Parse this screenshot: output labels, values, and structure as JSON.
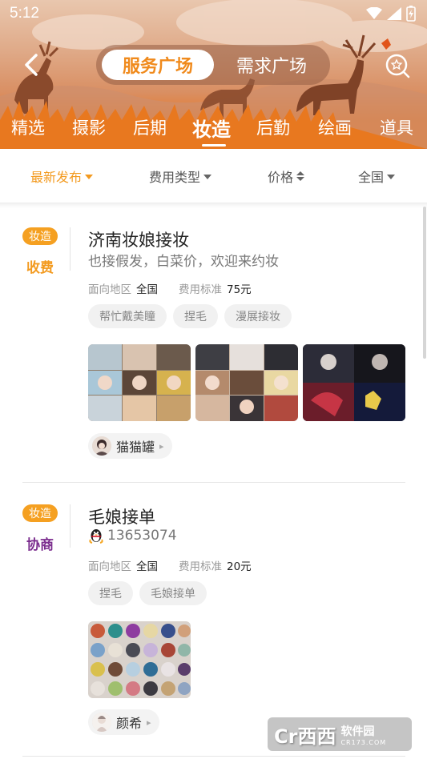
{
  "status_bar": {
    "time": "5:12"
  },
  "header": {
    "segment": {
      "active": "服务广场",
      "inactive": "需求广场"
    },
    "categories": [
      "精选",
      "摄影",
      "后期",
      "妆造",
      "后勤",
      "绘画",
      "道具"
    ],
    "active_category": "妆造",
    "colors": {
      "accent": "#e8781f",
      "active_text": "#f08a1c"
    }
  },
  "filters": {
    "latest": "最新发布",
    "fee_type": "费用类型",
    "price": "价格",
    "region": "全国",
    "active_color": "#f39a1f"
  },
  "cards": [
    {
      "category_badge": "妆造",
      "price_type": "收费",
      "price_type_color": "#f39a1f",
      "title": "济南妆娘接妆",
      "description": "也接假发，白菜价，欢迎来约妆",
      "meta": {
        "region_label": "面向地区",
        "region_value": "全国",
        "fee_label": "费用标准",
        "fee_value": "75元"
      },
      "tags": [
        "帮忙戴美瞳",
        "捏毛",
        "漫展接妆"
      ],
      "user": {
        "name": "猫猫罐"
      }
    },
    {
      "category_badge": "妆造",
      "price_type": "协商",
      "price_type_color": "#7b2d8e",
      "title": "毛娘接单",
      "qq": "13653074",
      "meta": {
        "region_label": "面向地区",
        "region_value": "全国",
        "fee_label": "费用标准",
        "fee_value": "20元"
      },
      "tags": [
        "捏毛",
        "毛娘接单"
      ],
      "user": {
        "name": "颜希"
      }
    }
  ],
  "watermark": {
    "logo": "Cr西西",
    "name": "软件园",
    "url": "CR173.COM"
  }
}
